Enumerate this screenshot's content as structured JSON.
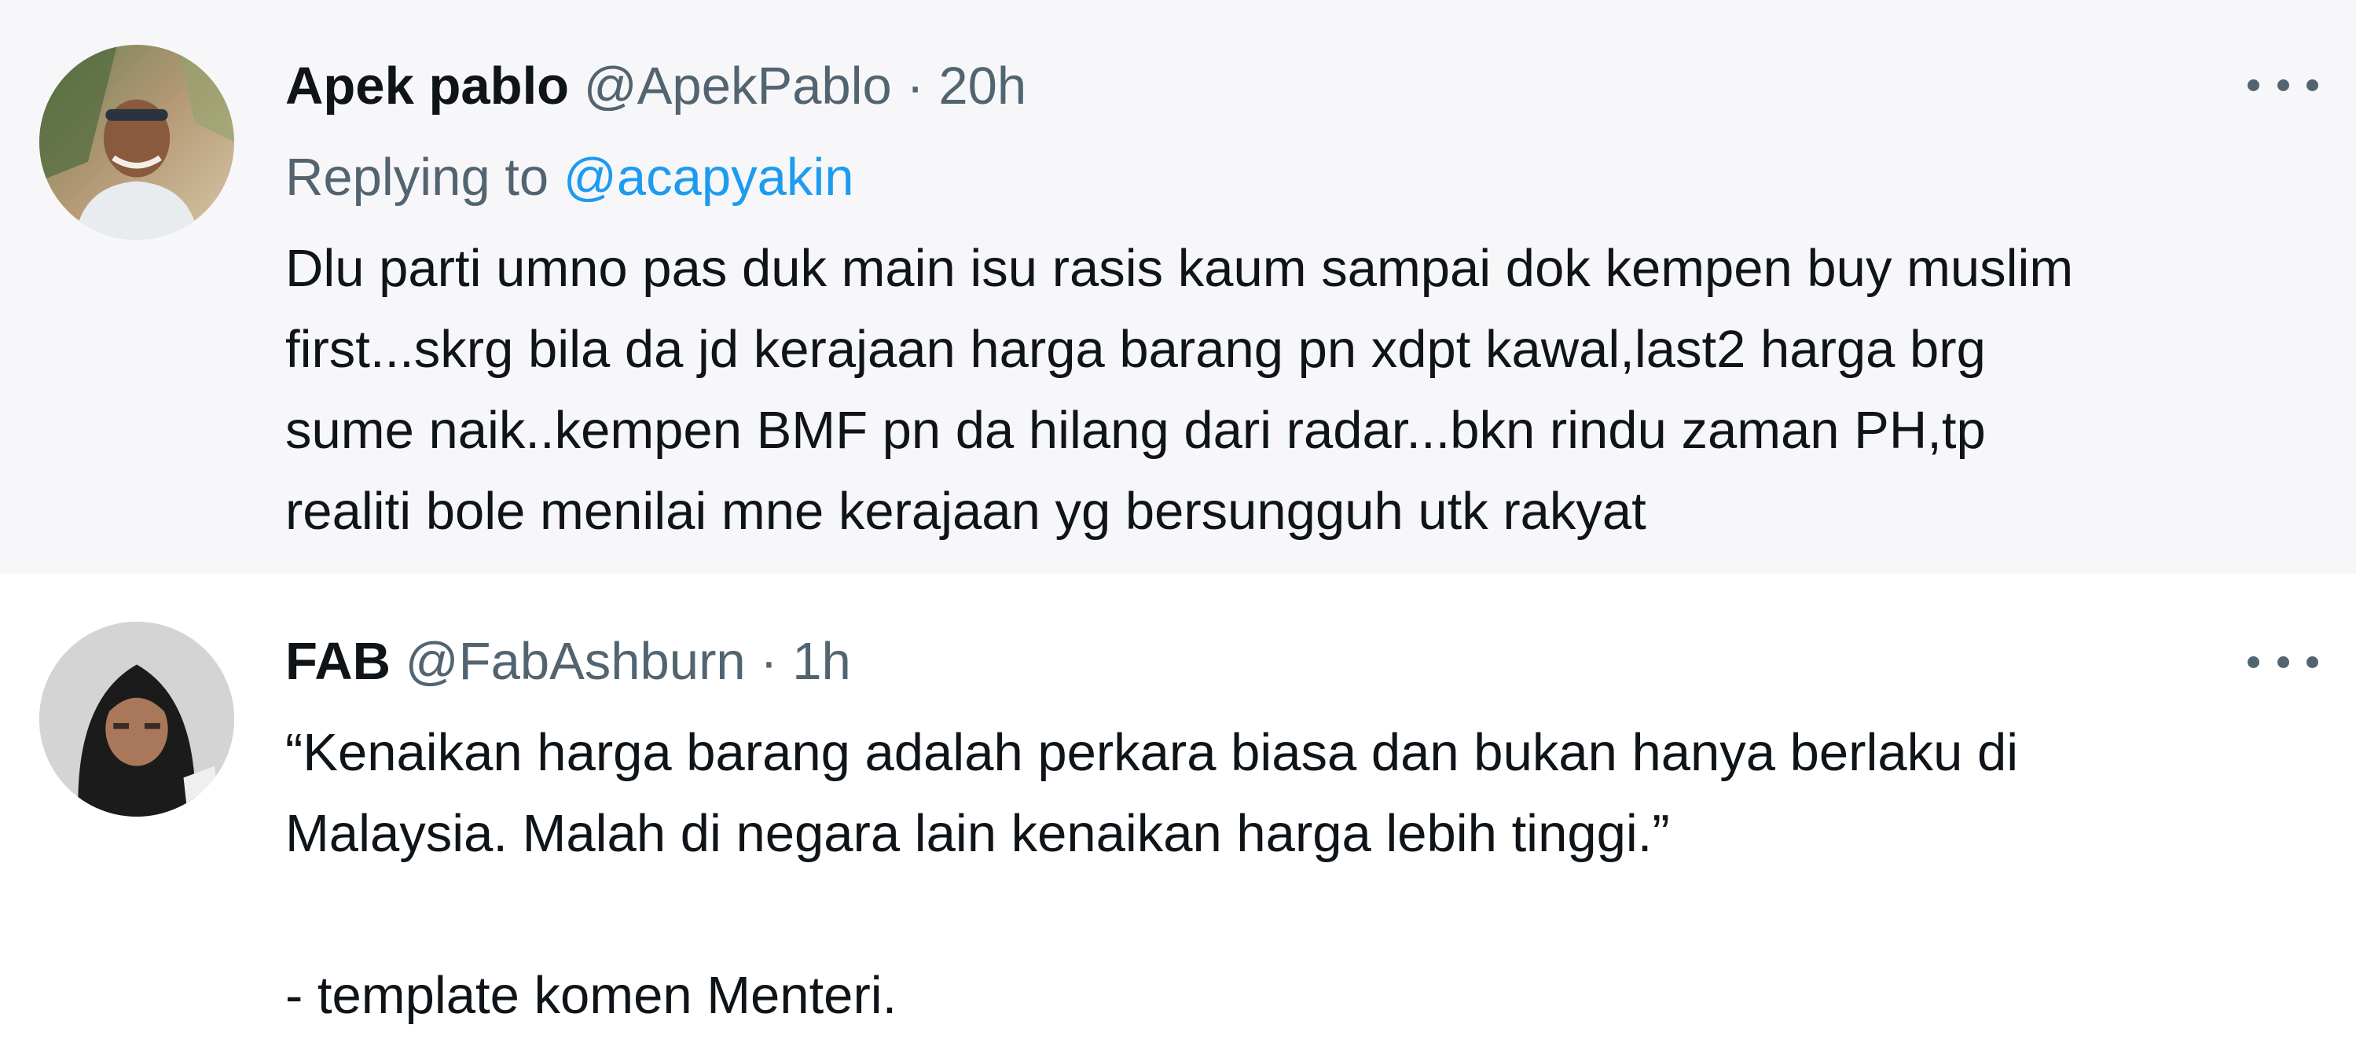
{
  "tweets": [
    {
      "name": "Apek pablo",
      "handle": "@ApekPablo",
      "separator": "·",
      "time": "20h",
      "replying_prefix": "Replying to",
      "replying_to": "@acapyakin",
      "lines": [
        "Dlu parti umno pas duk main isu rasis kaum sampai dok kempen buy muslim",
        "first...skrg bila da jd kerajaan harga barang pn xdpt kawal,last2 harga brg",
        "sume naik..kempen BMF pn da hilang dari radar...bkn rindu zaman PH,tp",
        "realiti bole menilai mne kerajaan yg bersungguh utk rakyat"
      ],
      "more_icon": "more-horizontal-icon"
    },
    {
      "name": "FAB",
      "handle": "@FabAshburn",
      "separator": "·",
      "time": "1h",
      "lines": [
        "“Kenaikan harga barang adalah perkara biasa dan bukan hanya berlaku di",
        "Malaysia. Malah di negara lain kenaikan harga lebih tinggi.”",
        "",
        "- template komen Menteri."
      ],
      "more_icon": "more-horizontal-icon"
    }
  ],
  "colors": {
    "text_primary": "#0f1419",
    "text_secondary": "#536471",
    "link": "#1d9bf0",
    "highlighted_background": "#f7f7f9"
  }
}
